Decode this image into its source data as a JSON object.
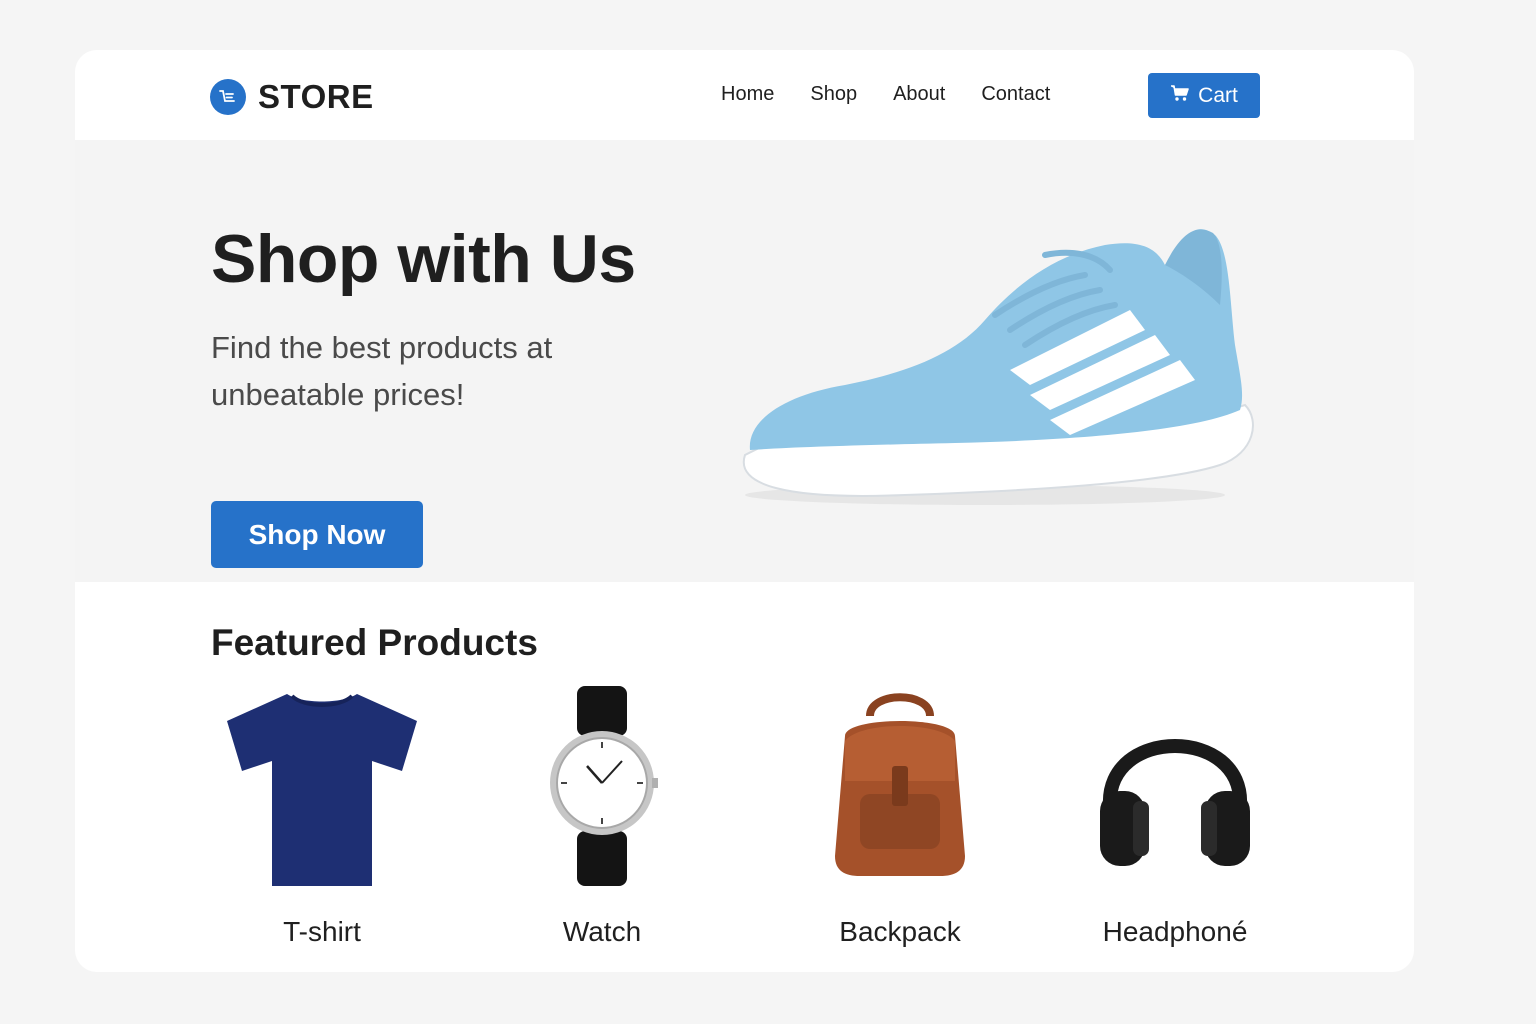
{
  "colors": {
    "accent": "#2672c9",
    "shoe": "#8fc6e6",
    "tshirt": "#1e2f73",
    "backpack": "#a5512a",
    "headphones": "#1a1a1a"
  },
  "header": {
    "logo_icon": "cart-logo-icon",
    "brand": "STORE",
    "nav": [
      "Home",
      "Shop",
      "About",
      "Contact"
    ],
    "cart_icon": "cart-icon",
    "cart_label": "Cart"
  },
  "hero": {
    "title": "Shop with Us",
    "subtitle": "Find the best products at unbeatable prices!",
    "cta_label": "Shop Now",
    "image": "sneaker-image"
  },
  "featured": {
    "title": "Featured Products",
    "products": [
      {
        "name": "T-shirt",
        "image": "tshirt-image"
      },
      {
        "name": "Watch",
        "image": "watch-image"
      },
      {
        "name": "Backpack",
        "image": "backpack-image"
      },
      {
        "name": "Headphoné",
        "image": "headphones-image"
      }
    ]
  }
}
